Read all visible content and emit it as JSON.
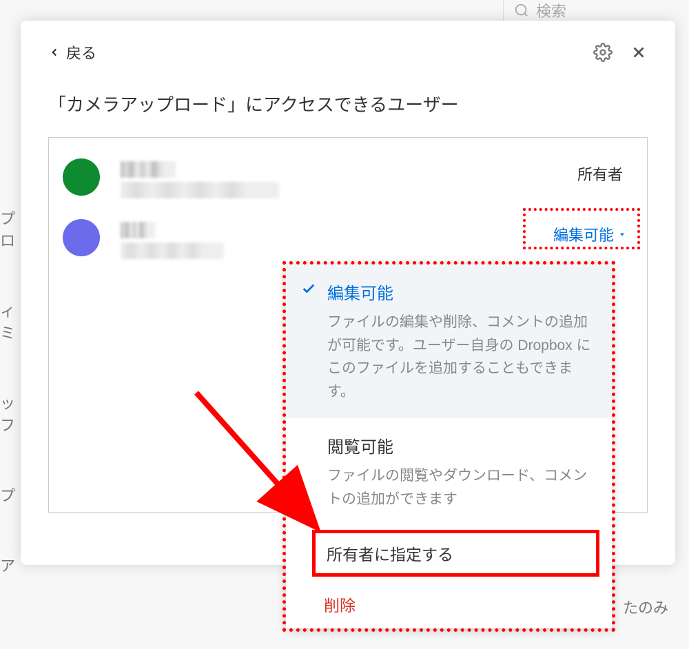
{
  "background": {
    "search_placeholder": "検索",
    "bottom_text": "たのみ"
  },
  "modal": {
    "back_label": "戻る",
    "title": "「カメラアップロード」にアクセスできるユーザー"
  },
  "users": [
    {
      "avatar_color": "green",
      "role_label": "所有者",
      "role_type": "static"
    },
    {
      "avatar_color": "purple",
      "role_label": "編集可能",
      "role_type": "dropdown"
    }
  ],
  "dropdown": {
    "items": [
      {
        "title": "編集可能",
        "description": "ファイルの編集や削除、コメントの追加が可能です。ユーザー自身の Dropbox にこのファイルを追加することもできます。",
        "selected": true
      },
      {
        "title": "閲覧可能",
        "description": "ファイルの閲覧やダウンロード、コメントの追加ができます",
        "selected": false
      }
    ],
    "actions": {
      "make_owner": "所有者に指定する",
      "remove": "削除"
    }
  },
  "colors": {
    "link_blue": "#0070e0",
    "annotation_red": "#ff0000",
    "danger_red": "#d93025",
    "avatar_green": "#0f8b2f",
    "avatar_purple": "#6b6bec"
  }
}
